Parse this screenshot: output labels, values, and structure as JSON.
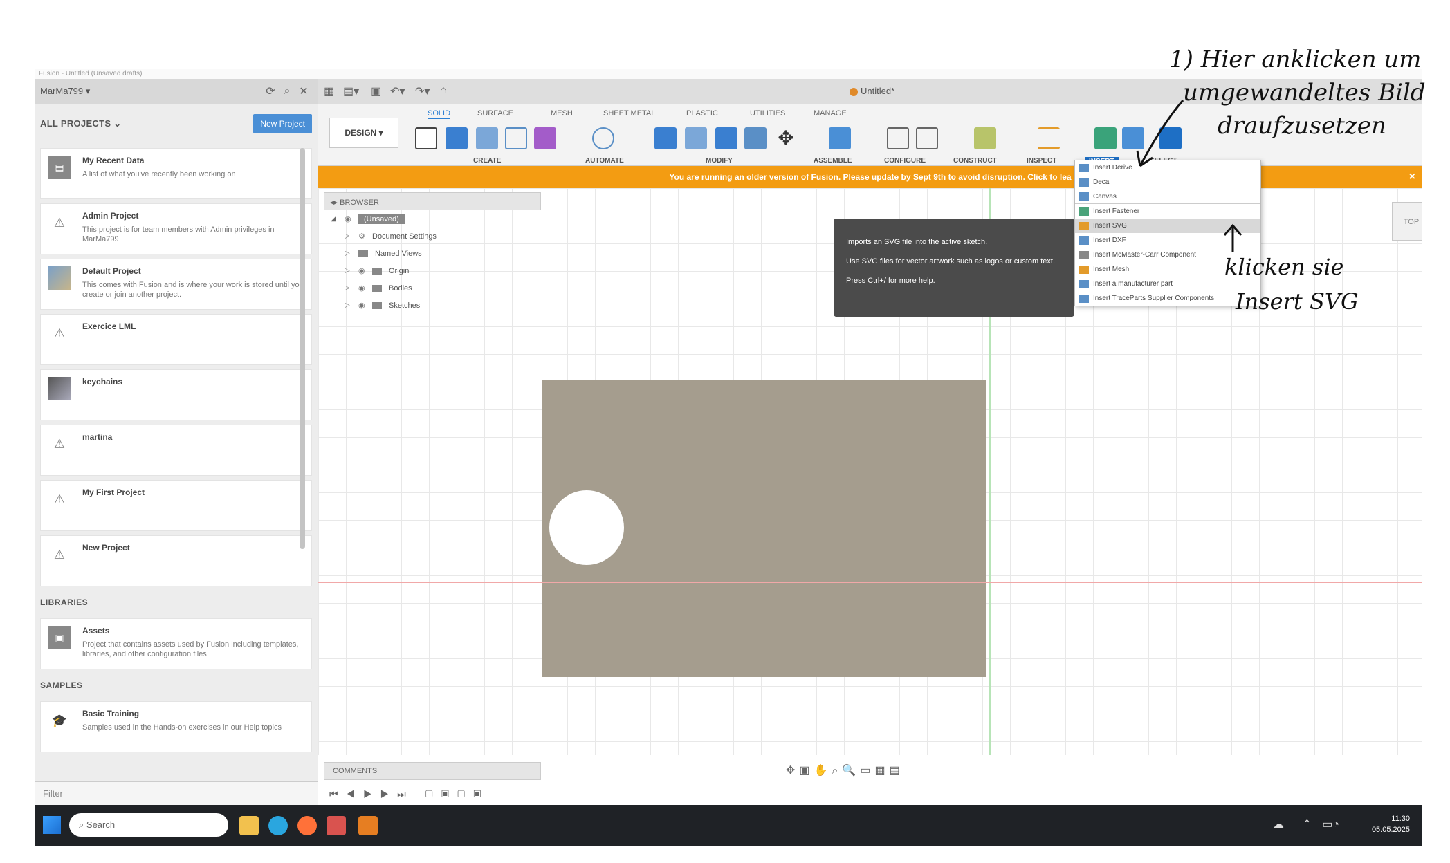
{
  "window": {
    "title": "Fusion - Untitled (Unsaved drafts)"
  },
  "data_panel": {
    "user": "MarMa799",
    "all_projects": "ALL PROJECTS",
    "new_project": "New Project",
    "projects": [
      {
        "name": "My Recent Data",
        "desc": "A list of what you've recently been working on"
      },
      {
        "name": "Admin Project",
        "desc": "This project is for team members with Admin privileges in MarMa799"
      },
      {
        "name": "Default Project",
        "desc": "This comes with Fusion and is where your work is stored until you create or join another project."
      },
      {
        "name": "Exercice LML",
        "desc": ""
      },
      {
        "name": "keychains",
        "desc": ""
      },
      {
        "name": "martina",
        "desc": ""
      },
      {
        "name": "My First Project",
        "desc": ""
      },
      {
        "name": "New Project",
        "desc": ""
      }
    ],
    "libraries_label": "LIBRARIES",
    "libraries": [
      {
        "name": "Assets",
        "desc": "Project that contains assets used by Fusion including templates, libraries, and other configuration files"
      }
    ],
    "samples_label": "SAMPLES",
    "samples": [
      {
        "name": "Basic Training",
        "desc": "Samples used in the Hands-on exercises in our Help topics"
      }
    ],
    "filter": "Filter"
  },
  "document": {
    "title": "Untitled*"
  },
  "toolbar": {
    "workspace": "DESIGN",
    "tabs": [
      "SOLID",
      "SURFACE",
      "MESH",
      "SHEET METAL",
      "PLASTIC",
      "UTILITIES",
      "MANAGE"
    ],
    "groups": [
      "CREATE",
      "AUTOMATE",
      "MODIFY",
      "ASSEMBLE",
      "CONFIGURE",
      "CONSTRUCT",
      "INSPECT",
      "INSERT",
      "SELECT"
    ]
  },
  "warning": {
    "text": "You are running an older version of Fusion. Please update by Sept 9th to avoid disruption. Click to lea",
    "close": "×"
  },
  "browser": {
    "header": "BROWSER",
    "root": "(Unsaved)",
    "items": [
      "Document Settings",
      "Named Views",
      "Origin",
      "Bodies",
      "Sketches"
    ]
  },
  "tooltip": {
    "line1": "Imports an SVG file into the active sketch.",
    "line2": "Use SVG files for vector artwork such as logos or custom text.",
    "line3": "Press Ctrl+/ for more help."
  },
  "insert_menu": {
    "items": [
      "Insert Derive",
      "Decal",
      "Canvas",
      "Insert Fastener",
      "Insert SVG",
      "Insert DXF",
      "Insert McMaster-Carr Component",
      "Insert Mesh",
      "Insert a manufacturer part",
      "Insert TraceParts Supplier Components"
    ],
    "highlighted": "Insert SVG"
  },
  "viewcube": {
    "label": "TOP"
  },
  "comments": {
    "label": "COMMENTS"
  },
  "taskbar": {
    "search": "Search",
    "time": "11:30",
    "date": "05.05.2025"
  },
  "annotations": {
    "top_note": "1) Hier anklicken um umgewandeltes Bild draufzusetzen",
    "top_line1": "1) Hier anklicken um",
    "top_line2": "umgewandeltes Bild",
    "top_line3": "draufzusetzen",
    "side_line1": "klicken sie",
    "side_line2": "Insert SVG"
  },
  "colors": {
    "accent": "#2b7fd4",
    "warning": "#f39c12",
    "body": "#a59d8e",
    "tooltip": "#4b4b4b"
  }
}
